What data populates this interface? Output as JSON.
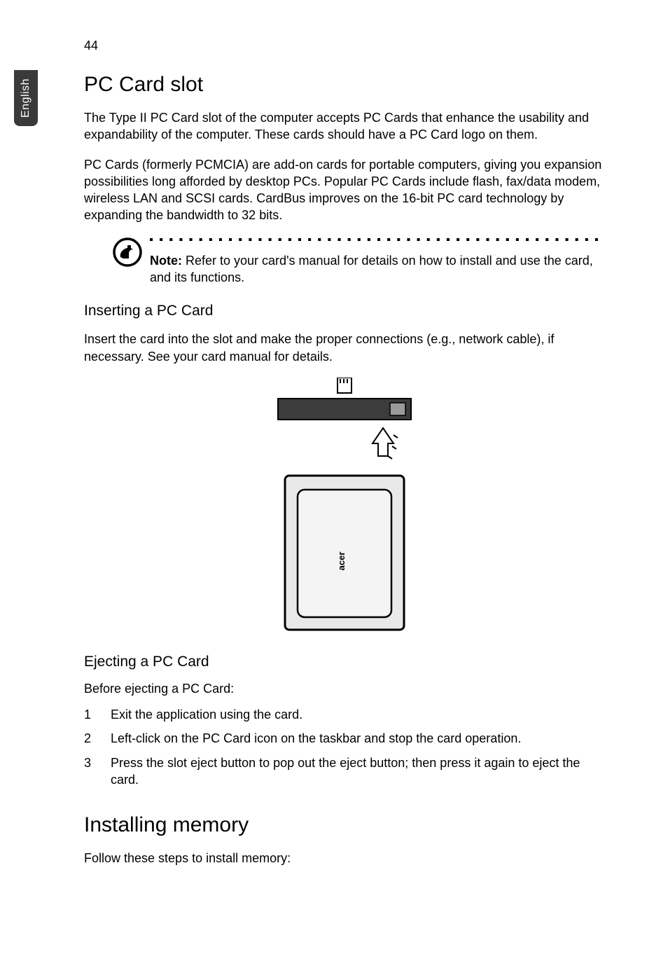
{
  "page_number": "44",
  "side_tab": "English",
  "section1": {
    "title": "PC Card slot",
    "para1": "The Type II PC Card slot of the computer accepts PC Cards that enhance the usability and expandability of the computer. These cards should have a PC Card logo on them.",
    "para2": "PC Cards (formerly PCMCIA) are add-on cards for portable computers, giving you expansion possibilities long afforded by desktop PCs. Popular PC Cards include flash, fax/data modem, wireless LAN and SCSI cards. CardBus improves on the 16-bit PC card technology by expanding the bandwidth to 32 bits.",
    "note_label": "Note:",
    "note_text": " Refer to your card's manual for details on how to install and use the card, and its functions."
  },
  "inserting": {
    "title": "Inserting a PC Card",
    "para": "Insert the card into the slot and make the proper connections (e.g., network cable), if necessary. See your card manual for details.",
    "card_brand": "acer"
  },
  "ejecting": {
    "title": "Ejecting a PC Card",
    "intro": "Before ejecting a PC Card:",
    "steps": [
      {
        "n": "1",
        "t": "Exit the application using the card."
      },
      {
        "n": "2",
        "t": "Left-click on the PC Card icon on the taskbar and stop the card operation."
      },
      {
        "n": "3",
        "t": "Press the slot eject button to pop out the eject button; then press it again to eject the card."
      }
    ]
  },
  "section2": {
    "title": "Installing memory",
    "para": "Follow these steps to install memory:"
  }
}
